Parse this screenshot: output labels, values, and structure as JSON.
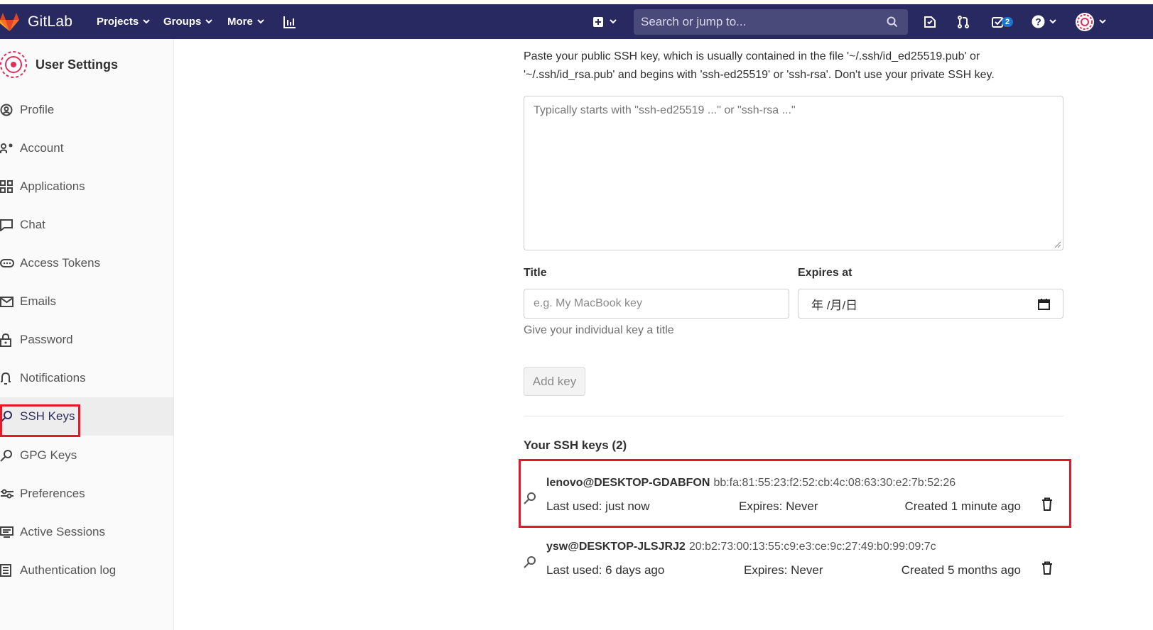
{
  "nav": {
    "brand": "GitLab",
    "projects": "Projects",
    "groups": "Groups",
    "more": "More",
    "search_placeholder": "Search or jump to...",
    "todo_count": "2"
  },
  "sidebar": {
    "title": "User Settings",
    "items": [
      {
        "label": "Profile",
        "icon": "profile-icon"
      },
      {
        "label": "Account",
        "icon": "account-icon"
      },
      {
        "label": "Applications",
        "icon": "applications-icon"
      },
      {
        "label": "Chat",
        "icon": "chat-icon"
      },
      {
        "label": "Access Tokens",
        "icon": "token-icon"
      },
      {
        "label": "Emails",
        "icon": "mail-icon"
      },
      {
        "label": "Password",
        "icon": "lock-icon"
      },
      {
        "label": "Notifications",
        "icon": "bell-icon"
      },
      {
        "label": "SSH Keys",
        "icon": "key-icon",
        "active": true
      },
      {
        "label": "GPG Keys",
        "icon": "key-icon"
      },
      {
        "label": "Preferences",
        "icon": "preferences-icon"
      },
      {
        "label": "Active Sessions",
        "icon": "monitor-icon"
      },
      {
        "label": "Authentication log",
        "icon": "log-icon"
      }
    ]
  },
  "form": {
    "instructions": "Paste your public SSH key, which is usually contained in the file '~/.ssh/id_ed25519.pub' or '~/.ssh/id_rsa.pub' and begins with 'ssh-ed25519' or 'ssh-rsa'. Don't use your private SSH key.",
    "key_placeholder": "Typically starts with \"ssh-ed25519 ...\" or \"ssh-rsa ...\"",
    "title_label": "Title",
    "title_placeholder": "e.g. My MacBook key",
    "title_help": "Give your individual key a title",
    "expires_label": "Expires at",
    "expires_value": "年 /月/日",
    "add_button": "Add key"
  },
  "keys": {
    "heading": "Your SSH keys (2)",
    "list": [
      {
        "name": "lenovo@DESKTOP-GDABFON",
        "fingerprint": "bb:fa:81:55:23:f2:52:cb:4c:08:63:30:e2:7b:52:26",
        "last_used": "Last used: just now",
        "expires": "Expires: Never",
        "created": "Created 1 minute ago"
      },
      {
        "name": "ysw@DESKTOP-JLSJRJ2",
        "fingerprint": "20:b2:73:00:13:55:c9:e3:ce:9c:27:49:b0:99:09:7c",
        "last_used": "Last used: 6 days ago",
        "expires": "Expires: Never",
        "created": "Created 5 months ago"
      }
    ]
  },
  "colors": {
    "navbar": "#292961",
    "highlight": "#e1192d",
    "gitlab_orange": "#fc6d26"
  }
}
